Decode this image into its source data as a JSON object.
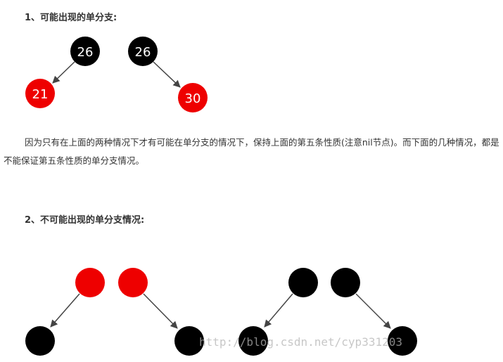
{
  "section1": {
    "heading": "1、可能出现的单分支:",
    "diagrams": [
      {
        "parent": {
          "label": "26",
          "color": "black"
        },
        "child": {
          "label": "21",
          "color": "red",
          "side": "left"
        }
      },
      {
        "parent": {
          "label": "26",
          "color": "black"
        },
        "child": {
          "label": "30",
          "color": "red",
          "side": "right"
        }
      }
    ]
  },
  "paragraph": {
    "line1": "因为只有在上面的两种情况下才有可能在单分支的情况下，保持上面的第五条性质(注意nil节点)。而下面的几",
    "line2": "种情况，都是不能保证第五条性质的单分支情况。"
  },
  "section2": {
    "heading": "2、不可能出现的单分支情况:",
    "diagrams": [
      {
        "parent_color": "red",
        "child_color": "black",
        "side": "left"
      },
      {
        "parent_color": "red",
        "child_color": "black",
        "side": "right"
      },
      {
        "parent_color": "black",
        "child_color": "black",
        "side": "left"
      },
      {
        "parent_color": "black",
        "child_color": "black",
        "side": "right"
      }
    ]
  },
  "watermark": "http://blog.csdn.net/cyp331203",
  "colors": {
    "red": "#ee0000",
    "black": "#000000",
    "edge": "#444444"
  }
}
